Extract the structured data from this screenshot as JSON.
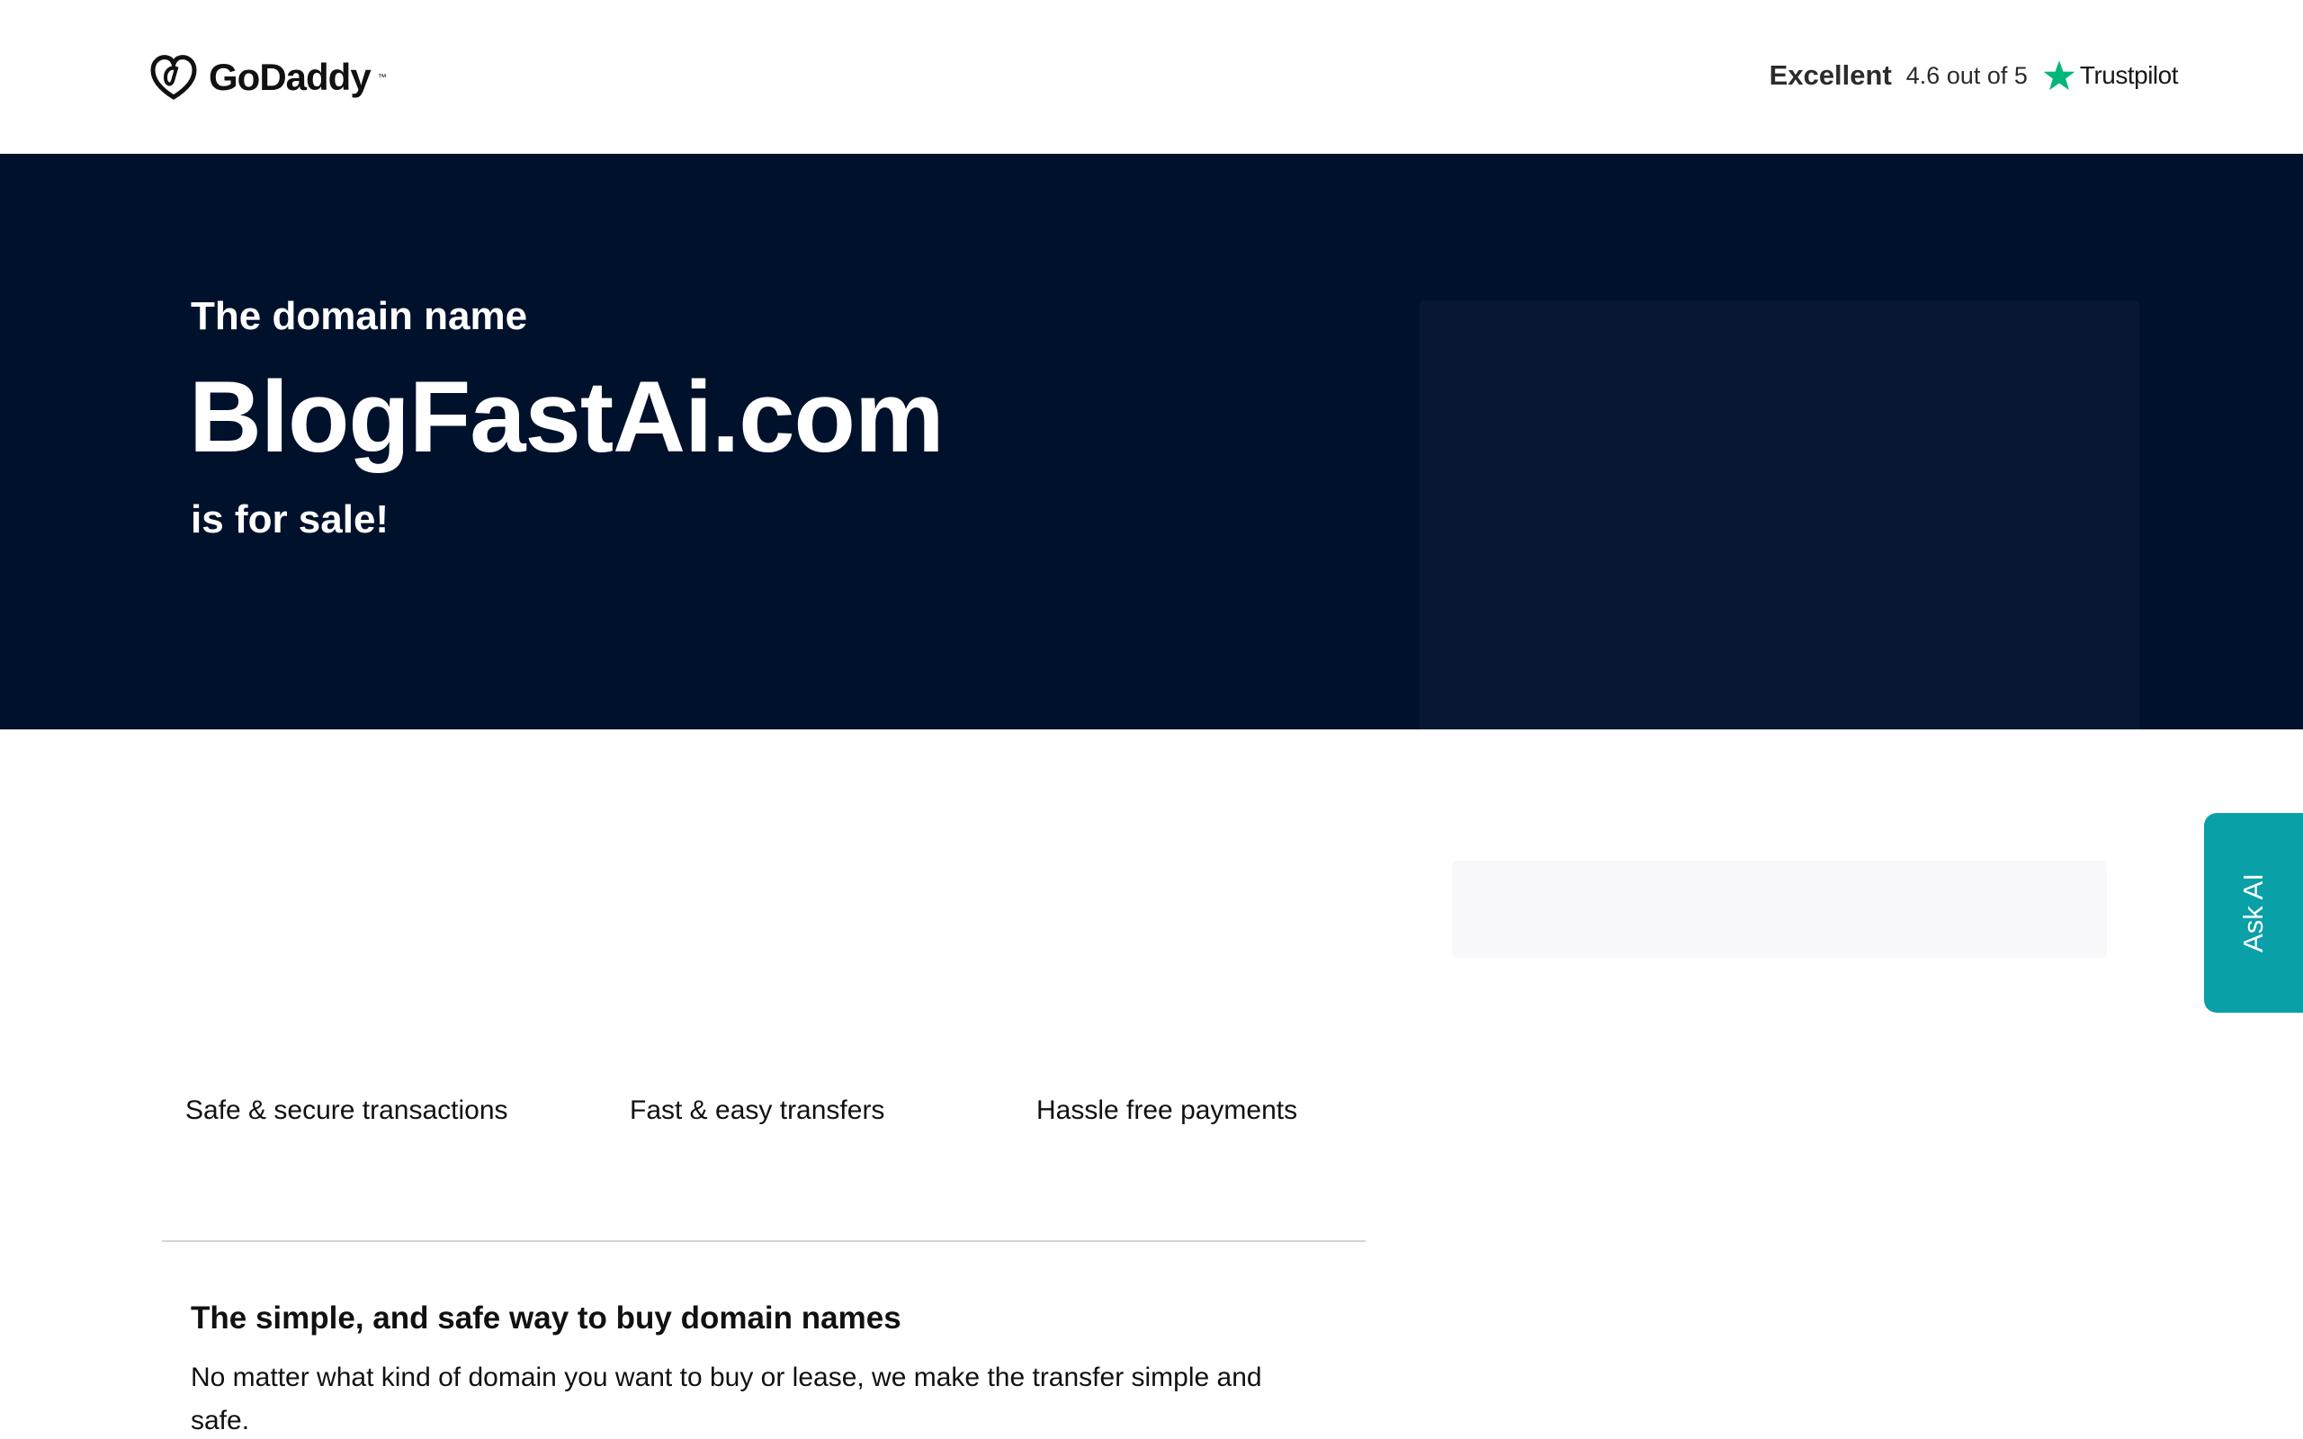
{
  "header": {
    "brand": "GoDaddy",
    "trademark": "™",
    "rating": {
      "label": "Excellent",
      "score": "4.6 out of 5",
      "provider": "Trustpilot",
      "star_color": "#00b67a"
    }
  },
  "hero": {
    "pre": "The domain name",
    "domain": "BlogFastAi.com",
    "post": "is for sale!",
    "background": "#00112c"
  },
  "features": [
    "Safe & secure transactions",
    "Fast & easy transfers",
    "Hassle free payments"
  ],
  "section": {
    "title": "The simple, and safe way to buy domain names",
    "body": "No matter what kind of domain you want to buy or lease, we make the transfer simple and safe."
  },
  "ask_ai": {
    "label": "Ask AI",
    "color": "#09a0a7"
  }
}
